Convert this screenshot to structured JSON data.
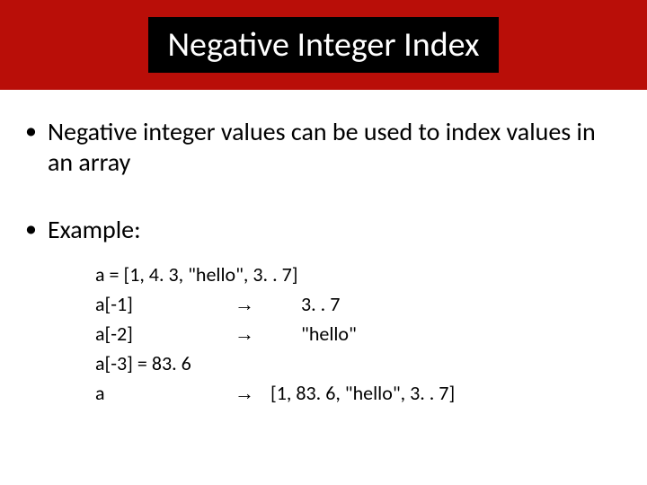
{
  "header": {
    "title": "Negative Integer Index"
  },
  "bullets": {
    "item1": "Negative integer values can be used to index values in an array",
    "item2": "Example:"
  },
  "code": {
    "line1_full": "a = [1, 4. 3, \"hello\", 3. . 7]",
    "line2": {
      "expr": "a[-1]",
      "arrow": "→",
      "result": "3. . 7"
    },
    "line3": {
      "expr": "a[-2]",
      "arrow": "→",
      "result": "\"hello\""
    },
    "line4_full": "a[-3] = 83. 6",
    "line5": {
      "expr": "a",
      "arrow": "→",
      "result": "[1, 83. 6,  \"hello\", 3. . 7]"
    }
  }
}
